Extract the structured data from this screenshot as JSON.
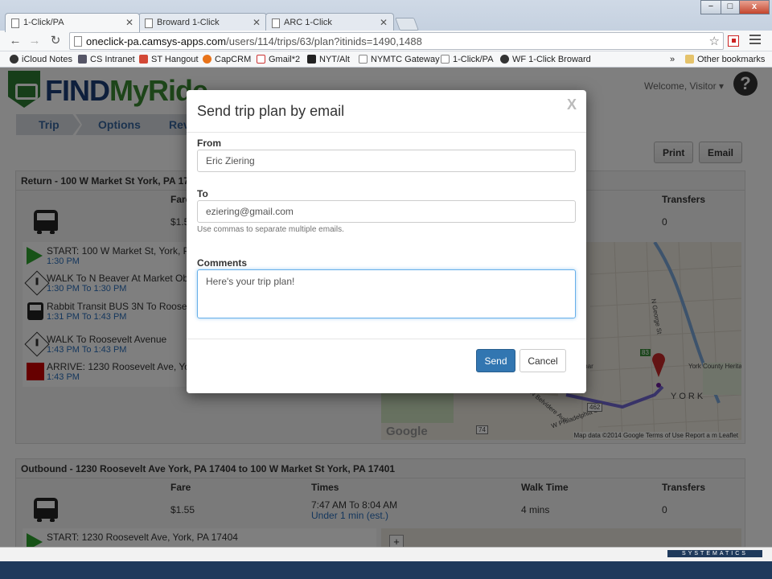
{
  "browser": {
    "tabs": [
      {
        "label": "1-Click/PA",
        "active": true
      },
      {
        "label": "Broward 1-Click",
        "active": false
      },
      {
        "label": "ARC 1-Click",
        "active": false
      }
    ],
    "window_controls": {
      "minimize": "−",
      "maximize": "□",
      "close": "x"
    },
    "url_host": "oneclick-pa.camsys-apps.com",
    "url_path": "/users/114/trips/63/plan?itinids=1490,1488",
    "bookmarks": [
      {
        "label": "iCloud Notes"
      },
      {
        "label": "CS Intranet"
      },
      {
        "label": "ST Hangout"
      },
      {
        "label": "CapCRM"
      },
      {
        "label": "Gmail*2"
      },
      {
        "label": "NYT/Alt"
      },
      {
        "label": "NYMTC Gateway"
      },
      {
        "label": "1-Click/PA"
      },
      {
        "label": "WF 1-Click Broward"
      }
    ],
    "bookmarks_overflow": "»",
    "other_bookmarks": "Other bookmarks"
  },
  "site": {
    "logo_find": "FIND",
    "logo_myride": "MyRide",
    "welcome": "Welcome, Visitor ▾",
    "help_glyph": "?",
    "breadcrumbs": [
      "Trip",
      "Options",
      "Rev"
    ],
    "print_label": "Print",
    "email_label": "Email"
  },
  "return_trip": {
    "header": "Return - 100 W Market St York, PA 17",
    "fare_header": "Fare",
    "fare": "$1.5",
    "transfers_header": "Transfers",
    "transfers": "0",
    "legs": [
      {
        "type": "start",
        "title": "START: 100 W Market St, York, P",
        "time": "1:30 PM"
      },
      {
        "type": "walk",
        "title": "WALK To N Beaver At Market Ob",
        "time": "1:30 PM To 1:30 PM"
      },
      {
        "type": "bus",
        "title": "Rabbit Transit BUS 3N To Roose",
        "time": "1:31 PM To 1:43 PM"
      },
      {
        "type": "walk",
        "title": "WALK To Roosevelt Avenue",
        "time": "1:43 PM To 1:43 PM"
      },
      {
        "type": "arrive",
        "title": "ARRIVE: 1230 Roosevelt Ave, Yo",
        "time": "1:43 PM"
      }
    ],
    "map": {
      "labels": [
        "N George St",
        "York County Heritage Trust",
        "YORK",
        "W Philadelphia St",
        "N Belvidere Ave",
        "mar"
      ],
      "route_badges": [
        "83",
        "462",
        "74"
      ],
      "google": "Google",
      "attribution": "Map data ©2014 Google   Terms of Use   Report a m   Leaflet"
    }
  },
  "outbound_trip": {
    "header": "Outbound - 1230 Roosevelt Ave York, PA 17404 to 100 W Market St York, PA 17401",
    "fare_header": "Fare",
    "times_header": "Times",
    "walk_header": "Walk Time",
    "transfers_header": "Transfers",
    "fare": "$1.55",
    "times": "7:47 AM To 8:04 AM",
    "eta": "Under 1 min (est.)",
    "walk": "4 mins",
    "transfers": "0",
    "first_leg": "START: 1230 Roosevelt Ave, York, PA 17404"
  },
  "modal": {
    "title": "Send trip plan by email",
    "close": "X",
    "from_label": "From",
    "from_value": "Eric Ziering",
    "to_label": "To",
    "to_value": "eziering@gmail.com",
    "to_help": "Use commas to separate multiple emails.",
    "comments_label": "Comments",
    "comments_value": "Here's your trip plan!",
    "send_label": "Send",
    "cancel_label": "Cancel"
  },
  "footer": {
    "brand": "SYSTEMATICS"
  },
  "colors": {
    "accent": "#3276b1",
    "brand_blue": "#1d3e78",
    "brand_green": "#3a8a33",
    "arrive_red": "#c00000",
    "start_green": "#2ea52e"
  }
}
